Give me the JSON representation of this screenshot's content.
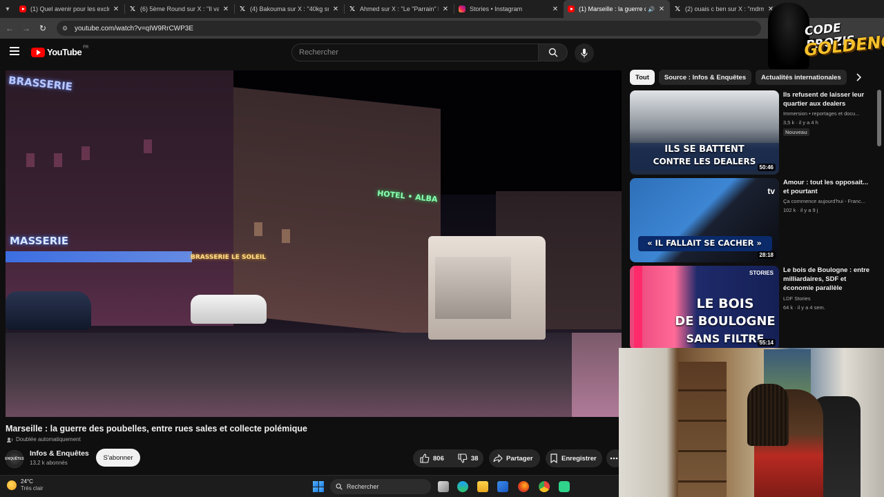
{
  "browser": {
    "tabs": [
      {
        "icon": "youtube-favicon",
        "title": "(1) Quel avenir pour les exclus",
        "active": false
      },
      {
        "icon": "x-favicon",
        "title": "(6) 5ème Round sur X : \"Il va sorti",
        "active": false
      },
      {
        "icon": "x-favicon",
        "title": "(4) Bakouma sur X : \"40kg sur u",
        "active": false
      },
      {
        "icon": "x-favicon",
        "title": "Ahmed sur X : \"Le \"Parrain\" bal",
        "active": false
      },
      {
        "icon": "instagram-favicon",
        "title": "Stories • Instagram",
        "active": false
      },
      {
        "icon": "youtube-favicon",
        "title": "(1) Marseille : la guerre des",
        "active": true,
        "audio": true
      },
      {
        "icon": "x-favicon",
        "title": "(2) ouais c ben sur X : \"mdrmm",
        "active": false
      }
    ],
    "url": "youtube.com/watch?v=qIW9RrCWP3E"
  },
  "youtube": {
    "logo_text": "YouTube",
    "country_code": "FR",
    "search_placeholder": "Rechercher"
  },
  "video": {
    "title": "Marseille : la guerre des poubelles, entre rues sales et collecte polémique",
    "dubbed_label": "Doublée automatiquement",
    "scene_signs": [
      "BRASSERIE",
      "MASSERIE",
      "HOTEL • ALBA",
      "BRASSERIE LE SOLEIL"
    ],
    "channel": {
      "name": "Infos & Enquêtes",
      "subscribers": "13,2 k abonnés",
      "avatar_text": "ENQUÊTES",
      "subscribe_label": "S'abonner"
    },
    "actions": {
      "likes": "806",
      "dislikes": "38",
      "share_label": "Partager",
      "save_label": "Enregistrer"
    }
  },
  "sidebar": {
    "chips": [
      "Tout",
      "Source : Infos & Enquêtes",
      "Actualités internationales",
      "V"
    ],
    "recommendations": [
      {
        "title": "Ils refusent de laisser leur quartier aux dealers",
        "channel": "Immersion • reportages et docu...",
        "meta": "3,5 k · il y a 4 h",
        "badge": "Nouveau",
        "duration": "50:46",
        "thumb_caption": [
          "ILS SE BATTENT",
          "CONTRE LES DEALERS"
        ]
      },
      {
        "title": "Amour : tout les opposait... et pourtant",
        "channel": "Ça commence aujourd'hui - Franc...",
        "meta": "102 k · il y a 9 j",
        "duration": "28:18",
        "thumb_caption": [
          "« IL FALLAIT SE CACHER »"
        ],
        "thumb_logo": "tv"
      },
      {
        "title": "Le bois de Boulogne : entre milliardaires, SDF et économie parallèle",
        "channel": "LDF Stories",
        "meta": "64 k · il y a 4 sem.",
        "duration": "55:14",
        "thumb_caption": [
          "LE BOIS",
          "DE BOULOGNE",
          "SANS FILTRE"
        ],
        "thumb_logo": "STORIES"
      }
    ]
  },
  "overlay": {
    "line1": "CODE PROZIS",
    "line2": "GOLDENG"
  },
  "taskbar": {
    "temperature": "24°C",
    "weather": "Très clair",
    "search_label": "Rechercher"
  },
  "colors": {
    "youtube_red": "#ff0000",
    "page_bg": "#0f0f0f",
    "brand_gold": "#f6c12a"
  }
}
